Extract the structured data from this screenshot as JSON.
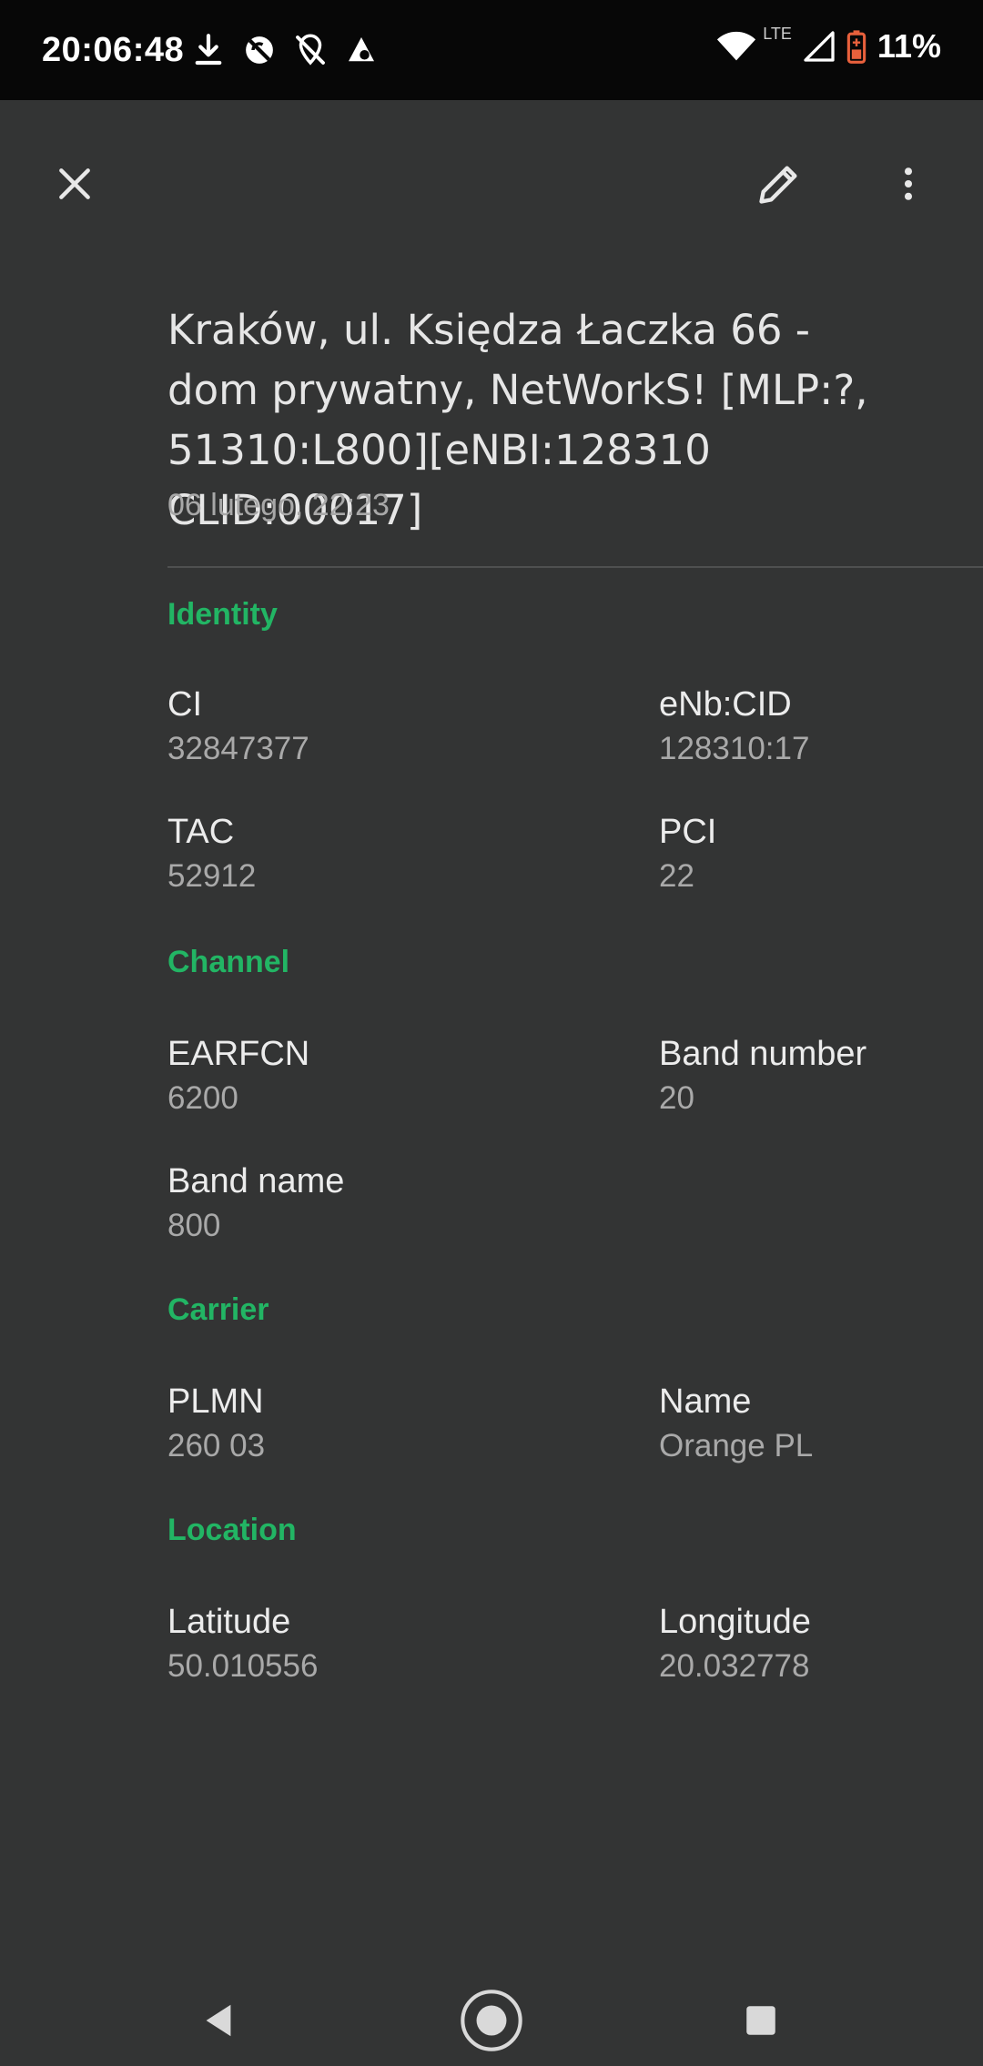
{
  "status_bar": {
    "time": "20:06:48",
    "network_label": "LTE",
    "battery": "11%",
    "icons_left": [
      "download-icon",
      "sync-off-icon",
      "location-off-icon",
      "notification-app-icon"
    ],
    "icons_right": [
      "wifi-icon",
      "signal-icon",
      "battery-low-icon"
    ]
  },
  "app_bar": {
    "actions": [
      "close-icon",
      "edit-icon",
      "more-vert-icon"
    ]
  },
  "header": {
    "title_lines": [
      "Kraków, ul. Księdza Łaczka 66 -",
      "dom prywatny, NetWorkS! [MLP:?,",
      "51310:L800][eNBI:128310 CLID:00017]"
    ],
    "subtitle": "06 lutego, 22:23"
  },
  "sections": {
    "identity": {
      "title": "Identity",
      "ci_label": "CI",
      "ci_value": "32847377",
      "enb_label": "eNb:CID",
      "enb_value": "128310:17",
      "tac_label": "TAC",
      "tac_value": "52912",
      "pci_label": "PCI",
      "pci_value": "22"
    },
    "channel": {
      "title": "Channel",
      "earfcn_label": "EARFCN",
      "earfcn_value": "6200",
      "band_number_label": "Band number",
      "band_number_value": "20",
      "band_name_label": "Band name",
      "band_name_value": "800"
    },
    "carrier": {
      "title": "Carrier",
      "plmn_label": "PLMN",
      "plmn_value": "260 03",
      "name_label": "Name",
      "name_value": "Orange PL"
    },
    "location": {
      "title": "Location",
      "lat_label": "Latitude",
      "lat_value": "50.010556",
      "lon_label": "Longitude",
      "lon_value": "20.032778"
    }
  },
  "colors": {
    "background": "#333434",
    "status_bar": "#070707",
    "accent": "#22b564",
    "battery_warning": "#e8603c"
  },
  "nav_bar": {
    "buttons": [
      "back-icon",
      "home-icon",
      "recents-icon"
    ]
  }
}
